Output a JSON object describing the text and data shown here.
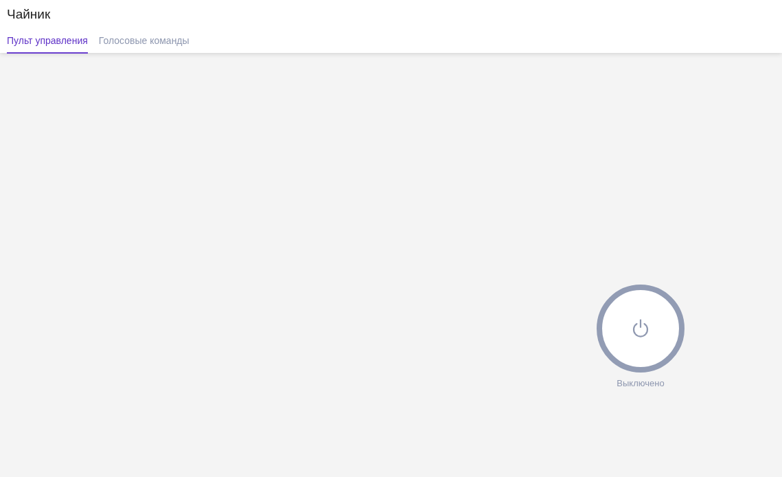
{
  "header": {
    "title": "Чайник"
  },
  "tabs": [
    {
      "label": "Пульт управления",
      "selected": true
    },
    {
      "label": "Голосовые команды",
      "selected": false
    }
  ],
  "power": {
    "on": false,
    "label": "Выключено"
  }
}
